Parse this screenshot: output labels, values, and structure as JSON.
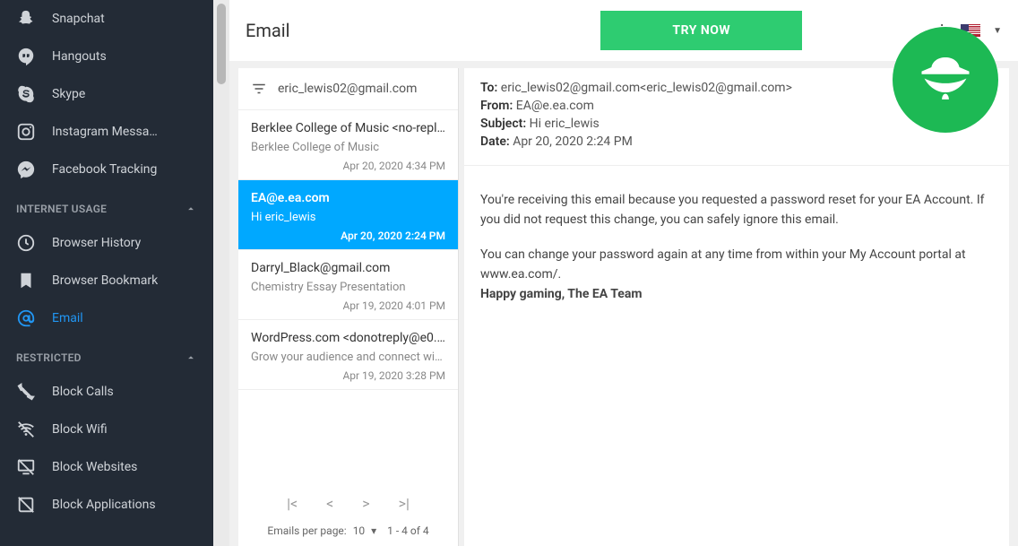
{
  "sidebar": {
    "items": [
      {
        "label": "Snapchat"
      },
      {
        "label": "Hangouts"
      },
      {
        "label": "Skype"
      },
      {
        "label": "Instagram Messa…"
      },
      {
        "label": "Facebook Tracking"
      }
    ],
    "section1": "INTERNET USAGE",
    "internet": [
      {
        "label": "Browser History"
      },
      {
        "label": "Browser Bookmark"
      },
      {
        "label": "Email"
      }
    ],
    "section2": "RESTRICTED",
    "restricted": [
      {
        "label": "Block Calls"
      },
      {
        "label": "Block Wifi"
      },
      {
        "label": "Block Websites"
      },
      {
        "label": "Block Applications"
      }
    ]
  },
  "topbar": {
    "title": "Email",
    "try_label": "TRY NOW"
  },
  "list": {
    "account": "eric_lewis02@gmail.com",
    "emails": [
      {
        "from": "Berklee College of Music <no-repl…",
        "subject": "Berklee College of Music",
        "date": "Apr 20, 2020 4:34 PM"
      },
      {
        "from": "EA@e.ea.com",
        "subject": "Hi eric_lewis",
        "date": "Apr 20, 2020 2:24 PM"
      },
      {
        "from": "Darryl_Black@gmail.com",
        "subject": "Chemistry Essay Presentation",
        "date": "Apr 19, 2020 4:01 PM"
      },
      {
        "from": "WordPress.com <donotreply@e0.…",
        "subject": "Grow your audience and connect with …",
        "date": "Apr 19, 2020 3:28 PM"
      }
    ],
    "per_page_label": "Emails per page:",
    "per_page_value": "10",
    "range": "1 - 4 of 4"
  },
  "message": {
    "to_label": "To:",
    "to": "eric_lewis02@gmail.com<eric_lewis02@gmail.com>",
    "from_label": "From:",
    "from": "EA@e.ea.com",
    "subject_label": "Subject:",
    "subject": "Hi eric_lewis",
    "date_label": "Date:",
    "date": "Apr 20, 2020 2:24 PM",
    "body1": "You're receiving this email because you requested a password reset for your EA Account. If you did not request this change, you can safely ignore this email.",
    "body2": "You can change your password again at any time from within your My Account portal at www.ea.com/.",
    "signoff": "Happy gaming, The EA Team"
  }
}
